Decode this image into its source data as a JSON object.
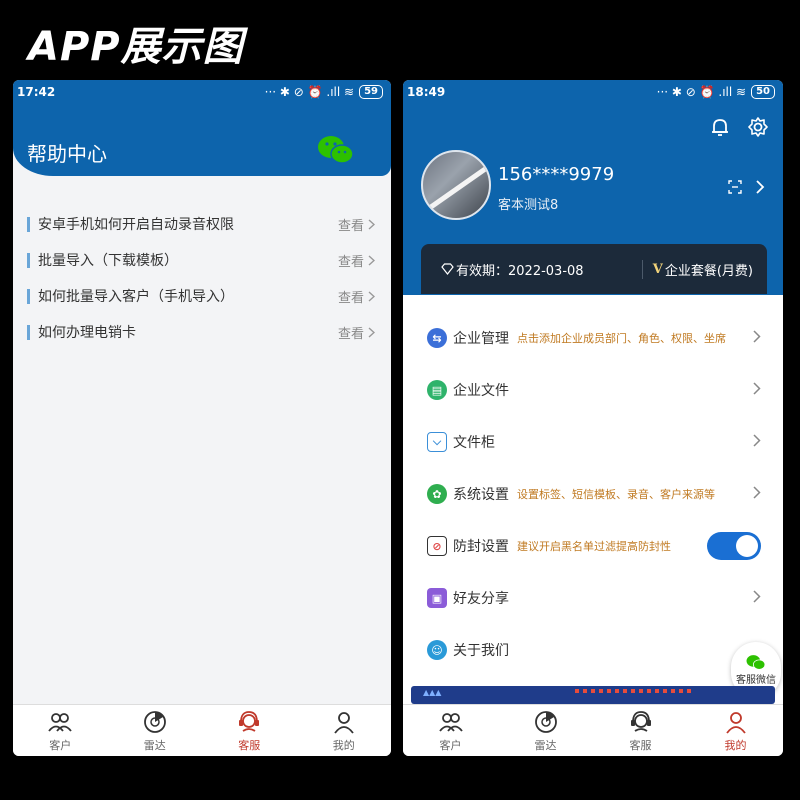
{
  "banner": {
    "title": "APP展示图"
  },
  "phone1": {
    "status": {
      "time": "17:42",
      "icons": "··· ✱ ⊘ ⏰ .ıll ≋",
      "battery": "59"
    },
    "header": {
      "title": "帮助中心"
    },
    "help_items": [
      {
        "text": "安卓手机如何开启自动录音权限",
        "action": "查看"
      },
      {
        "text": "批量导入（下载模板）",
        "action": "查看"
      },
      {
        "text": "如何批量导入客户（手机导入）",
        "action": "查看"
      },
      {
        "text": "如何办理电销卡",
        "action": "查看"
      }
    ],
    "tabs": [
      {
        "label": "客户",
        "icon": "users-icon"
      },
      {
        "label": "雷达",
        "icon": "radar-icon"
      },
      {
        "label": "客服",
        "icon": "headset-icon",
        "active": true
      },
      {
        "label": "我的",
        "icon": "person-icon"
      }
    ]
  },
  "phone2": {
    "status": {
      "time": "18:49",
      "icons": "··· ✱ ⊘ ⏰ .ıll ≋",
      "battery": "50"
    },
    "profile": {
      "phone": "156****9979",
      "name": "客本测试8"
    },
    "vip": {
      "expire": "有效期：2022-03-08",
      "plan_mark": "V",
      "plan": "企业套餐(月费)"
    },
    "menu": [
      {
        "label": "企业管理",
        "hint": "点击添加企业成员部门、角色、权限、坐席",
        "icon": "enterprise-icon",
        "color": "#3b6fd8",
        "type": "chevron"
      },
      {
        "label": "企业文件",
        "hint": "",
        "icon": "file-icon",
        "color": "#2fb36b",
        "type": "chevron"
      },
      {
        "label": "文件柜",
        "hint": "",
        "icon": "cabinet-icon",
        "color": "#3b8fd8",
        "type": "chevron"
      },
      {
        "label": "系统设置",
        "hint": "设置标签、短信模板、录音、客户来源等",
        "icon": "settings-icon",
        "color": "#2fae4f",
        "type": "chevron"
      },
      {
        "label": "防封设置",
        "hint": "建议开启黑名单过滤提高防封性",
        "icon": "shield-phone-icon",
        "color": "#e04848",
        "type": "toggle"
      },
      {
        "label": "好友分享",
        "hint": "",
        "icon": "share-icon",
        "color": "#8b5cd8",
        "type": "chevron"
      },
      {
        "label": "关于我们",
        "hint": "",
        "icon": "about-icon",
        "color": "#2a9ad8",
        "type": "none"
      }
    ],
    "kf_float": {
      "label": "客服微信"
    },
    "tabs": [
      {
        "label": "客户",
        "icon": "users-icon"
      },
      {
        "label": "雷达",
        "icon": "radar-icon"
      },
      {
        "label": "客服",
        "icon": "headset-icon"
      },
      {
        "label": "我的",
        "icon": "person-icon",
        "active": true
      }
    ]
  }
}
